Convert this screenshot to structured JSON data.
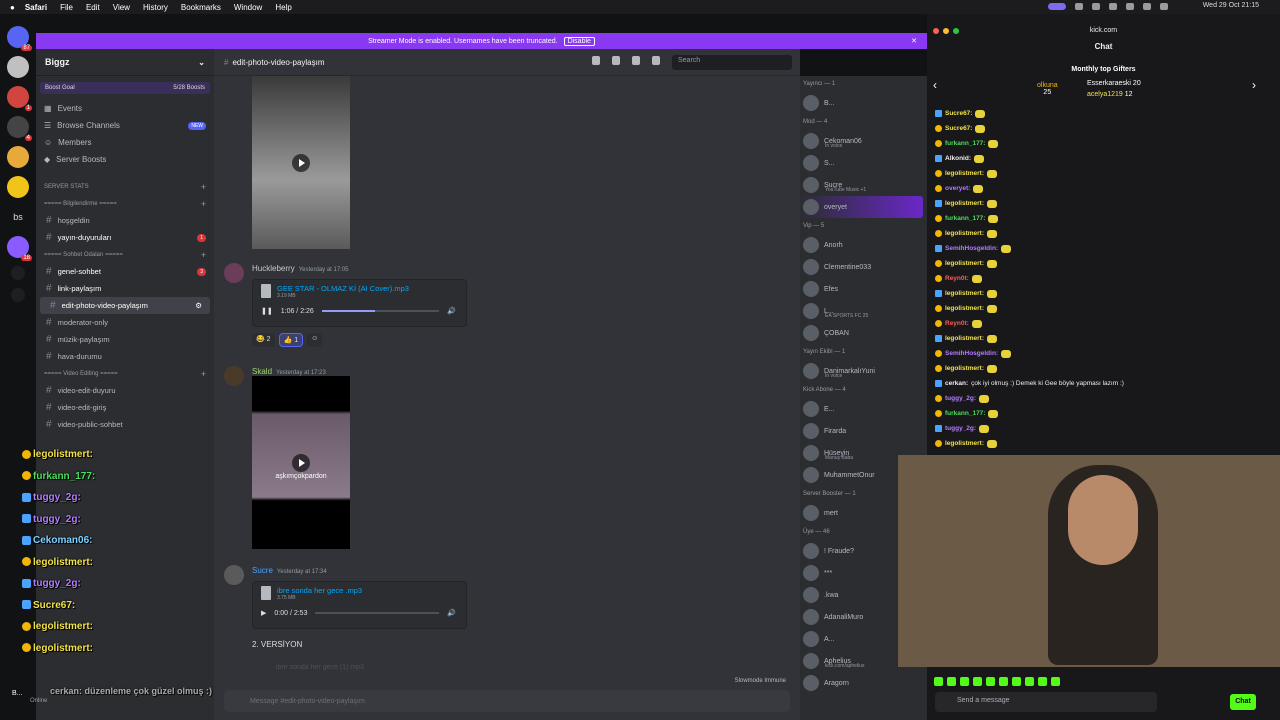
{
  "menubar": {
    "app": "Safari",
    "items": [
      "File",
      "Edit",
      "View",
      "History",
      "Bookmarks",
      "Window",
      "Help"
    ],
    "clock": "Wed 29 Oct 21:15"
  },
  "servers": [
    {
      "badge": "87"
    },
    {
      "badge": ""
    },
    {
      "badge": "1"
    },
    {
      "badge": "4"
    },
    {
      "badge": ""
    },
    {
      "badge": ""
    },
    {
      "badge": ""
    },
    {
      "badge": "18"
    },
    {
      "badge": ""
    },
    {
      "badge": ""
    }
  ],
  "server_label": "bs",
  "banner": {
    "text": "Streamer Mode is enabled. Usernames have been truncated.",
    "button": "Disable"
  },
  "guild": {
    "name": "Biggz",
    "boost_goal": "Boost Goal",
    "boosts": "5/28 Boosts"
  },
  "nav": [
    {
      "label": "Events",
      "new": ""
    },
    {
      "label": "Browse Channels",
      "new": "NEW"
    },
    {
      "label": "Members",
      "new": ""
    },
    {
      "label": "Server Boosts",
      "new": ""
    }
  ],
  "categories": {
    "stats": "SERVER STATS",
    "bilgi": "===== Bilgilendirme =====",
    "sohbet": "===== Sohbet Odaları =====",
    "video": "===== Video Editing ====="
  },
  "channels": {
    "bilgi": [
      {
        "name": "hoşgeldin",
        "badge": ""
      },
      {
        "name": "yayın-duyuruları",
        "badge": "1"
      }
    ],
    "sohbet": [
      {
        "name": "genel-sohbet",
        "badge": "3"
      },
      {
        "name": "link-paylaşım",
        "badge": ""
      },
      {
        "name": "edit-photo-video-paylaşım",
        "badge": ""
      },
      {
        "name": "moderator-only",
        "badge": ""
      },
      {
        "name": "müzik-paylaşım",
        "badge": ""
      },
      {
        "name": "hava-durumu",
        "badge": ""
      }
    ],
    "video": [
      {
        "name": "video-edit-duyuru"
      },
      {
        "name": "video-edit-giriş"
      },
      {
        "name": "video-public-sohbet"
      }
    ]
  },
  "channel_header": {
    "name": "edit-photo-video-paylaşım",
    "search": "Search"
  },
  "messages": {
    "m1": {
      "user": "Huckleberry",
      "time": "Yesterday at 17:05",
      "file": "GEE STAR - OLMAZ Kİ (AI Cover).mp3",
      "size": "3.19 MB",
      "time_played": "1:06 / 2:26",
      "reactions": [
        "😂 2",
        "👍 1",
        "☺"
      ]
    },
    "m2": {
      "user": "Skald",
      "time": "Yesterday at 17:23",
      "video_caption": "aşkımçokpardon"
    },
    "m3": {
      "user": "Sucre",
      "time": "Yesterday at 17:34",
      "file": "ibre sonda her gece .mp3",
      "size": "3.75 MB",
      "time_played": "0:00 / 2:53",
      "text": "2. VERSİYON",
      "file2": "ibre sonda her gece (1).mp3"
    }
  },
  "input_placeholder": "Message #edit-photo-video-paylaşım",
  "slowmode": "Slowmode Immune",
  "progress": {
    "m1": 0.45,
    "m3": 0.0
  },
  "members": {
    "groups": [
      {
        "title": "Yayıncı — 1",
        "items": [
          {
            "name": "B...",
            "sub": ""
          }
        ]
      },
      {
        "title": "Mod — 4",
        "items": [
          {
            "name": "Cekoman06",
            "sub": "In voice"
          },
          {
            "name": "S...",
            "sub": ""
          },
          {
            "name": "Sucre",
            "sub": "YouTube Music +1"
          },
          {
            "name": "overyet",
            "sub": ""
          }
        ]
      },
      {
        "title": "Vip — 5",
        "items": [
          {
            "name": "Anorh",
            "sub": ""
          },
          {
            "name": "Clementine033",
            "sub": ""
          },
          {
            "name": "Efes",
            "sub": ""
          },
          {
            "name": "L...",
            "sub": "EA SPORTS FC 25"
          },
          {
            "name": "ÇOBAN",
            "sub": ""
          }
        ]
      },
      {
        "title": "Yayın Ekibi — 1",
        "items": [
          {
            "name": "DanimarkalıYuni",
            "sub": "In voice"
          }
        ]
      },
      {
        "title": "Kick Abone — 4",
        "items": [
          {
            "name": "E...",
            "sub": ""
          },
          {
            "name": "Firarda",
            "sub": ""
          },
          {
            "name": "Hüseyin",
            "sub": "Manuş Baba"
          },
          {
            "name": "MuhammetOnur",
            "sub": ""
          }
        ]
      },
      {
        "title": "Server Booster — 1",
        "items": [
          {
            "name": "mert",
            "sub": ""
          }
        ]
      },
      {
        "title": "Üye — 46",
        "items": [
          {
            "name": "! Fraude?",
            "sub": ""
          },
          {
            "name": "***",
            "sub": ""
          },
          {
            "name": ".kwa",
            "sub": ""
          },
          {
            "name": "AdanaliMuro",
            "sub": ""
          },
          {
            "name": "A...",
            "sub": ""
          },
          {
            "name": "Aphelius",
            "sub": "kick.com/aphelius"
          },
          {
            "name": "Aragorn",
            "sub": ""
          }
        ]
      }
    ]
  },
  "overlay": [
    {
      "name": "legolistmert:",
      "color": "#f2e24a",
      "icon": "circle"
    },
    {
      "name": "furkann_177:",
      "color": "#4ade5a",
      "icon": ""
    },
    {
      "name": "tuggy_2g:",
      "color": "#b57cff",
      "icon": "badge"
    },
    {
      "name": "tuggy_2g:",
      "color": "#b57cff",
      "icon": "badge"
    },
    {
      "name": "Cekoman06:",
      "color": "#7fd1ff",
      "icon": "badge"
    },
    {
      "name": "legolistmert:",
      "color": "#f2e24a",
      "icon": "circle"
    },
    {
      "name": "tuggy_2g:",
      "color": "#b57cff",
      "icon": "badge"
    },
    {
      "name": "Sucre67:",
      "color": "#f2e24a",
      "icon": "badge"
    },
    {
      "name": "legolistmert:",
      "color": "#f2e24a",
      "icon": "circle"
    },
    {
      "name": "legolistmert:",
      "color": "#f2e24a",
      "icon": "circle"
    }
  ],
  "overlay_bottom": "cerkan: düzenleme çok güzel olmuş :)",
  "user_status": {
    "name": "B...",
    "status": "Online"
  },
  "kick": {
    "url": "kick.com",
    "title": "Chat",
    "gifters_title": "Monthly top Gifters",
    "gifters": [
      {
        "name": "olkuna",
        "count": "25"
      },
      {
        "name": "Esserkaraeski",
        "count": "20"
      },
      {
        "name": "acelya1219",
        "count": "12"
      }
    ],
    "messages": [
      {
        "user": "Sucre67:",
        "color": "#f2e24a",
        "text": ""
      },
      {
        "user": "Sucre67:",
        "color": "#f2e24a",
        "text": ""
      },
      {
        "user": "furkann_177:",
        "color": "#4ade5a",
        "text": ""
      },
      {
        "user": "Alkonid:",
        "color": "#efeff1",
        "text": ""
      },
      {
        "user": "legolistmert:",
        "color": "#f2e24a",
        "text": ""
      },
      {
        "user": "overyet:",
        "color": "#b57cff",
        "text": ""
      },
      {
        "user": "legolistmert:",
        "color": "#f2e24a",
        "text": ""
      },
      {
        "user": "furkann_177:",
        "color": "#4ade5a",
        "text": ""
      },
      {
        "user": "legolistmert:",
        "color": "#f2e24a",
        "text": ""
      },
      {
        "user": "SemihHosgeldin:",
        "color": "#b57cff",
        "text": ""
      },
      {
        "user": "legolistmert:",
        "color": "#f2e24a",
        "text": ""
      },
      {
        "user": "Reyn0t:",
        "color": "#ff5a5a",
        "text": ""
      },
      {
        "user": "legolistmert:",
        "color": "#f2e24a",
        "text": ""
      },
      {
        "user": "legolistmert:",
        "color": "#f2e24a",
        "text": ""
      },
      {
        "user": "Reyn0t:",
        "color": "#ff5a5a",
        "text": ""
      },
      {
        "user": "legolistmert:",
        "color": "#f2e24a",
        "text": ""
      },
      {
        "user": "SemihHosgeldin:",
        "color": "#b57cff",
        "text": ""
      },
      {
        "user": "legolistmert:",
        "color": "#f2e24a",
        "text": ""
      },
      {
        "user": "cerkan:",
        "color": "#efeff1",
        "text": "çok iyi olmuş :) Demek ki Gee böyle yapması lazım :)"
      },
      {
        "user": "tuggy_2g:",
        "color": "#b57cff",
        "text": ""
      },
      {
        "user": "furkann_177:",
        "color": "#4ade5a",
        "text": ""
      },
      {
        "user": "tuggy_2g:",
        "color": "#b57cff",
        "text": ""
      },
      {
        "user": "legolistmert:",
        "color": "#f2e24a",
        "text": ""
      }
    ],
    "input_placeholder": "Send a message",
    "send": "Chat"
  }
}
